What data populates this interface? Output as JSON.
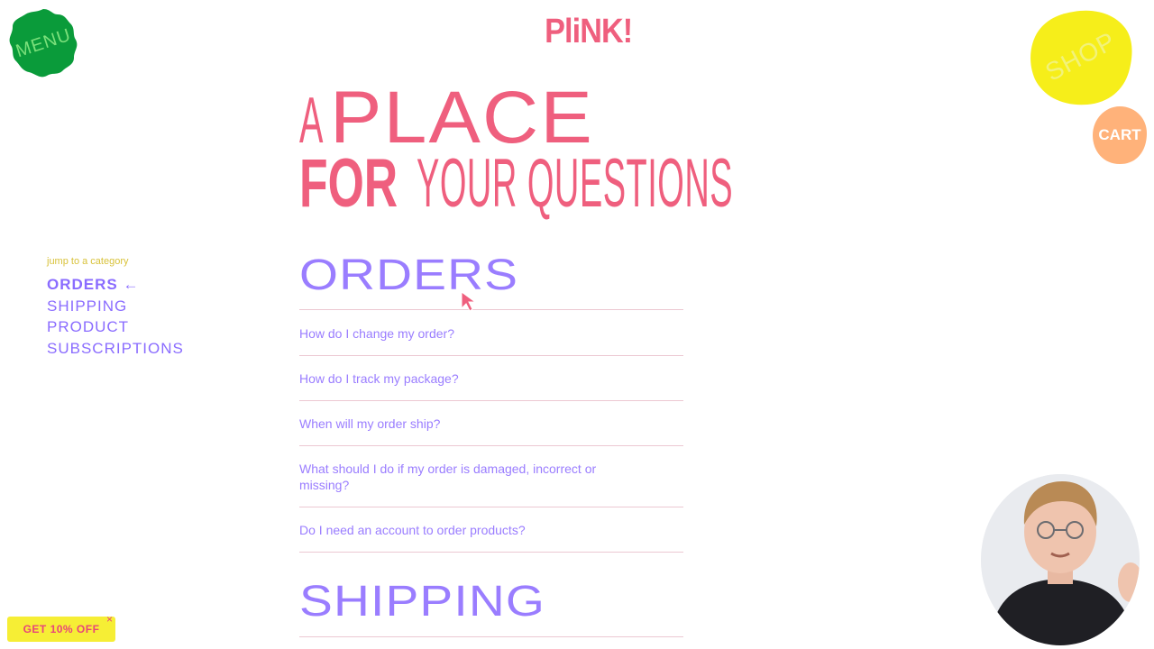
{
  "nav": {
    "menu_label": "MENU",
    "shop_label": "SHOP",
    "cart_label": "CART"
  },
  "logo": {
    "text": "PliNK!"
  },
  "hero": {
    "line1_a": "A",
    "line1_b": "PLACE",
    "line2_a": "FOR",
    "line2_b": "YOUR QUESTIONS"
  },
  "sidebar": {
    "jump_label": "jump to a category",
    "items": [
      {
        "label": "ORDERS ←"
      },
      {
        "label": "SHIPPING"
      },
      {
        "label": "PRODUCT"
      },
      {
        "label": "SUBSCRIPTIONS"
      }
    ]
  },
  "sections": [
    {
      "title": "ORDERS",
      "questions": [
        "How do I change my order?",
        "How do I track my package?",
        "When will my order ship?",
        "What should I do if my order is damaged, incorrect or missing?",
        "Do I need an account to order products?"
      ]
    },
    {
      "title": "SHIPPING"
    }
  ],
  "promo": {
    "label": "GET 10% OFF",
    "close": "×"
  },
  "colors": {
    "pink": "#ef5f7e",
    "purple": "#9a7dff",
    "menu_green": "#0a9b3a",
    "shop_yellow": "#f6ee1a",
    "cart_orange": "#ffb27a",
    "promo_yellow": "#f6ee35"
  },
  "icons": [
    "arrow-left-icon",
    "mouse-cursor-icon",
    "close-icon"
  ]
}
